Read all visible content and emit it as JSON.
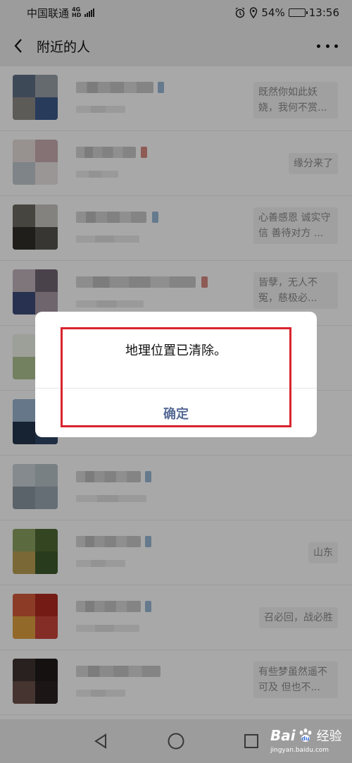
{
  "status_bar": {
    "carrier": "中国联通",
    "network_top": "4G",
    "network_bottom": "HD",
    "battery": "54%",
    "battery_level": 0.54,
    "time": "13:56"
  },
  "header": {
    "title": "附近的人"
  },
  "list": {
    "items": [
      {
        "signature": "既然你如此妖娆，我何不赏..."
      },
      {
        "signature": "缘分来了"
      },
      {
        "signature": "心善感恩   诚实守信   善待对方 ..."
      },
      {
        "signature": "皆孽，无人不冤，慈极必..."
      },
      {
        "signature": ""
      },
      {
        "signature": ""
      },
      {
        "signature": ""
      },
      {
        "signature": "山东"
      },
      {
        "signature": "召必回，战必胜"
      },
      {
        "signature": "有些梦虽然遥不可及 但也不..."
      },
      {
        "signature": ""
      }
    ]
  },
  "dialog": {
    "message": "地理位置已清除。",
    "confirm_label": "确定",
    "accent_color": "#576b95"
  },
  "highlight_color": "#d9232e",
  "watermark": {
    "brand_left": "Bai",
    "brand_right": "经验",
    "url": "jingyan.baidu.com"
  }
}
